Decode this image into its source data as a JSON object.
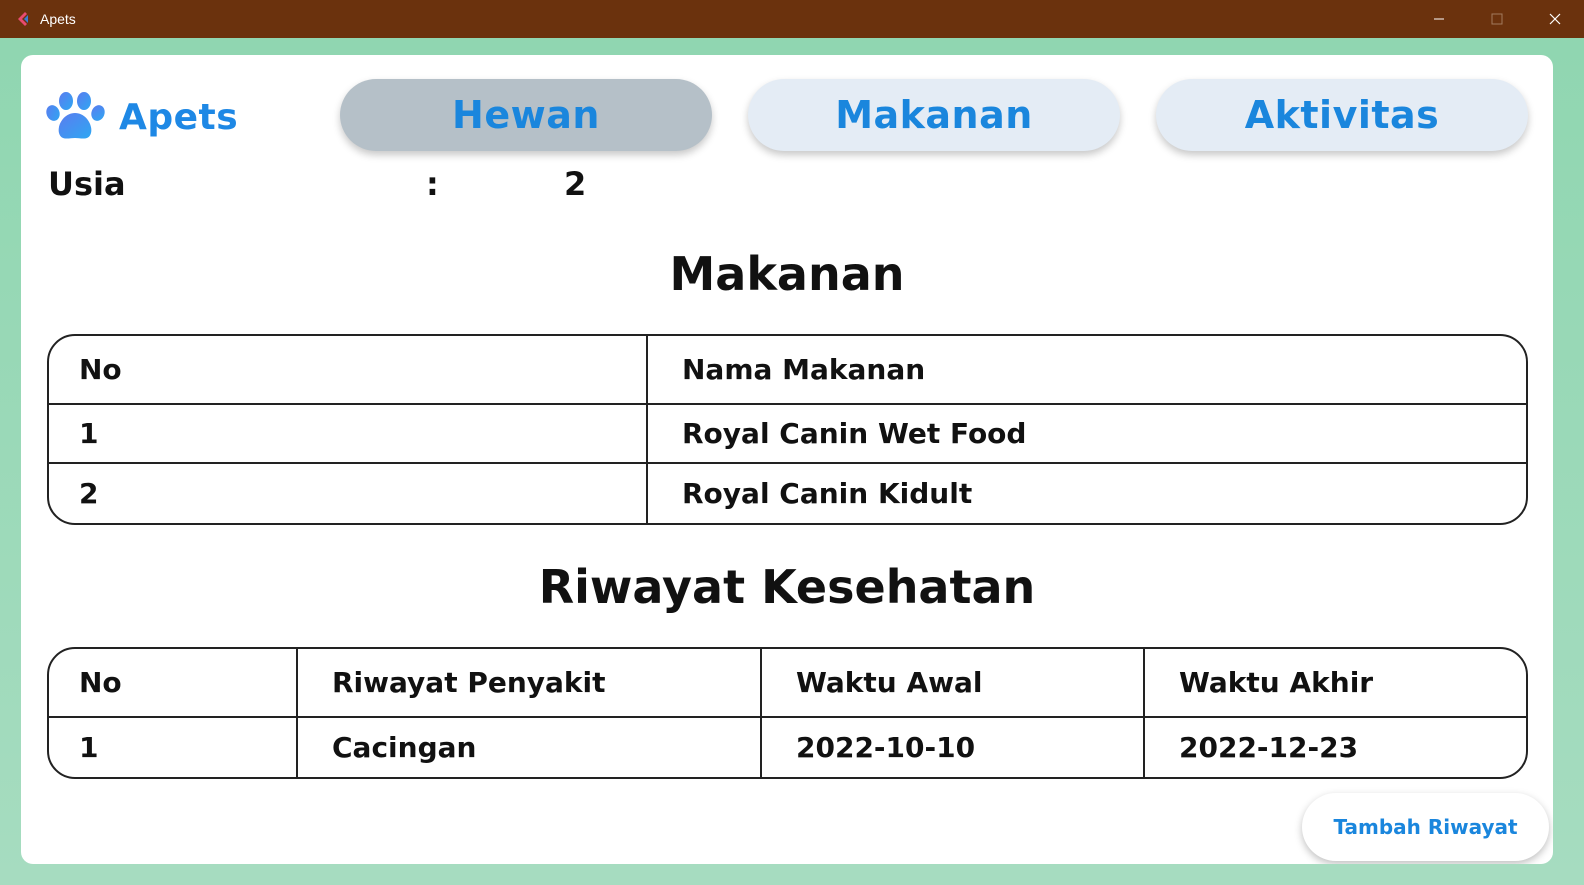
{
  "window": {
    "title": "Apets",
    "icon": "app-logo-icon",
    "controls": [
      "minimize-icon",
      "maximize-icon",
      "close-icon"
    ]
  },
  "brand": {
    "name": "Apets",
    "icon": "paw-icon"
  },
  "nav": {
    "hewan": "Hewan",
    "makanan": "Makanan",
    "aktivitas": "Aktivitas",
    "active": "Hewan"
  },
  "detail": {
    "label": "Usia",
    "colon": ":",
    "value": "2"
  },
  "makanan_section": {
    "title": "Makanan",
    "headers": [
      "No",
      "Nama Makanan"
    ],
    "rows": [
      [
        "1",
        "Royal Canin Wet Food"
      ],
      [
        "2",
        "Royal Canin Kidult"
      ]
    ]
  },
  "riwayat_section": {
    "title": "Riwayat Kesehatan",
    "headers": [
      "No",
      "Riwayat Penyakit",
      "Waktu Awal",
      "Waktu Akhir"
    ],
    "rows": [
      [
        "1",
        "Cacingan",
        "2022-10-10",
        "2022-12-23"
      ]
    ]
  },
  "actions": {
    "add_history": "Tambah Riwayat"
  },
  "colors": {
    "titlebar": "#6b320d",
    "accent": "#1a86dd",
    "nav_active": "#b5c0c8",
    "nav_inactive": "#e4ecf5",
    "background": "#8fd6b0"
  }
}
